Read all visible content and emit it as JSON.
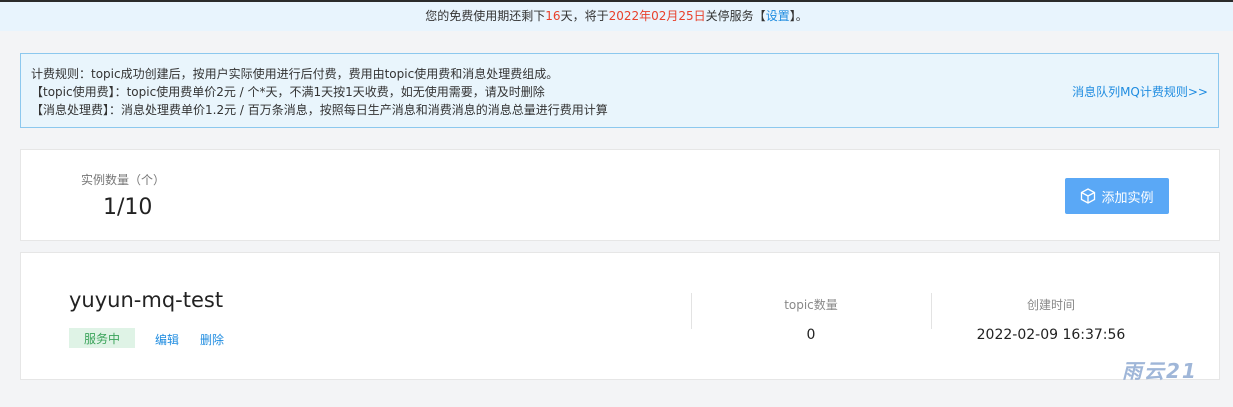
{
  "banner": {
    "prefix": "您的免费使用期还剩下",
    "days": "16",
    "middle": "天，将于",
    "date": "2022年02月25日",
    "suffix": "关停服务【",
    "settings_link": "设置",
    "end": "】。"
  },
  "billing_notice": {
    "line1": "计费规则：topic成功创建后，按用户实际使用进行后付费，费用由topic使用费和消息处理费组成。",
    "line2": "【topic使用费】：topic使用费单价2元 / 个*天，不满1天按1天收费，如无使用需要，请及时删除",
    "line3": "【消息处理费】：消息处理费单价1.2元 / 百万条消息，按照每日生产消息和消费消息的消息总量进行费用计算",
    "rules_link": "消息队列MQ计费规则>>"
  },
  "stats": {
    "label": "实例数量（个）",
    "value": "1/10",
    "add_button": "添加实例"
  },
  "instance": {
    "name": "yuyun-mq-test",
    "status": "服务中",
    "edit": "编辑",
    "delete": "删除",
    "topic_label": "topic数量",
    "topic_value": "0",
    "created_label": "创建时间",
    "created_value": "2022-02-09 16:37:56"
  },
  "watermark": "雨云21",
  "colors": {
    "accent": "#1f8ce0",
    "button": "#5aa8f6",
    "warning_red": "#e8412c",
    "status_green": "#3aa35a"
  }
}
